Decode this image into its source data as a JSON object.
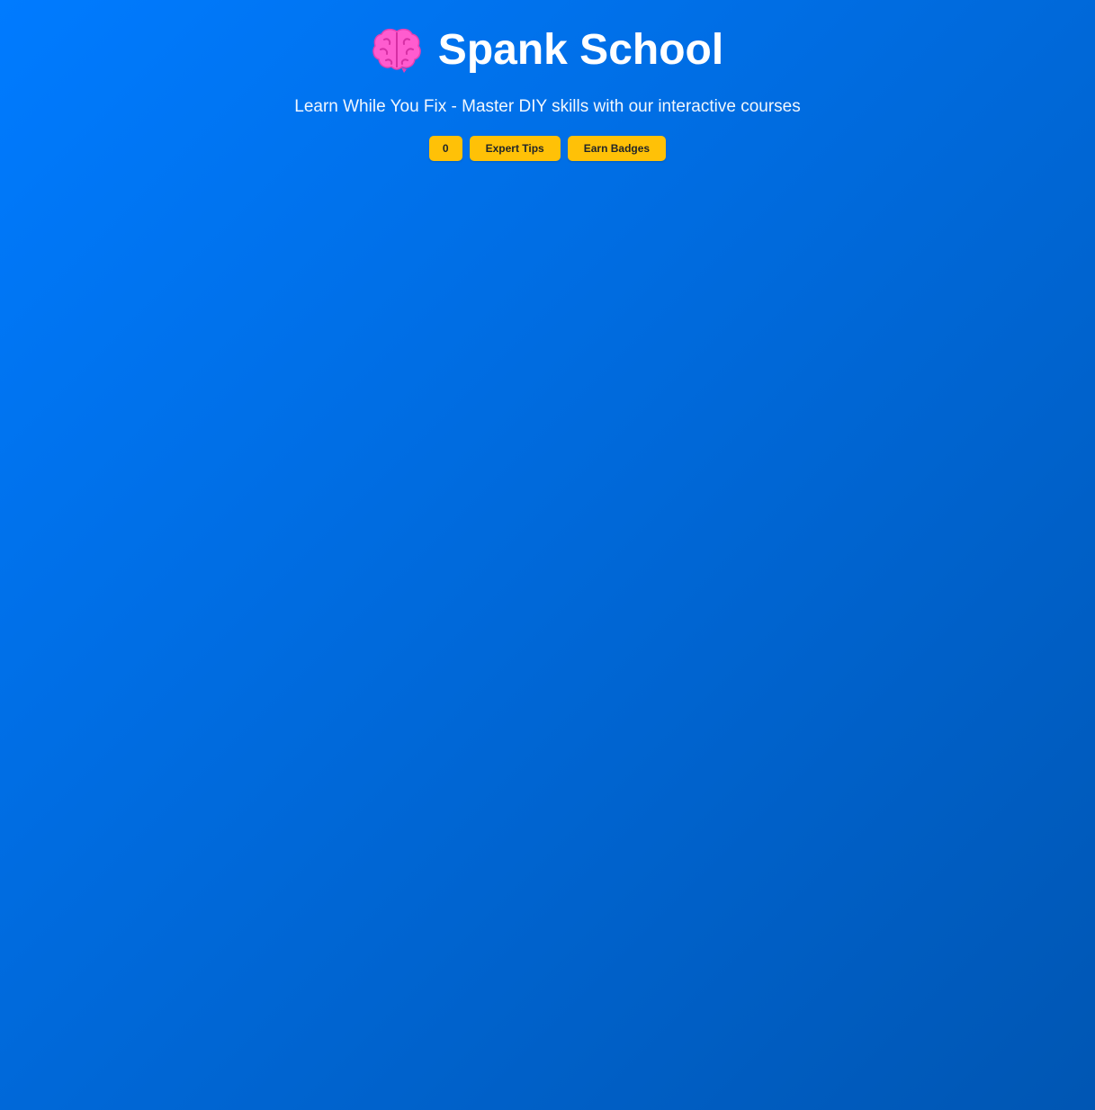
{
  "header": {
    "icon": "brain-icon",
    "title": "Spank School",
    "tagline": "Learn While You Fix - Master DIY skills with our interactive courses"
  },
  "actions": {
    "count_label": "0",
    "tips_label": "Expert Tips",
    "badges_label": "Earn Badges"
  },
  "colors": {
    "background_start": "#007bff",
    "background_end": "#0056b3",
    "button": "#ffc107",
    "icon": "#ff4fc0"
  }
}
